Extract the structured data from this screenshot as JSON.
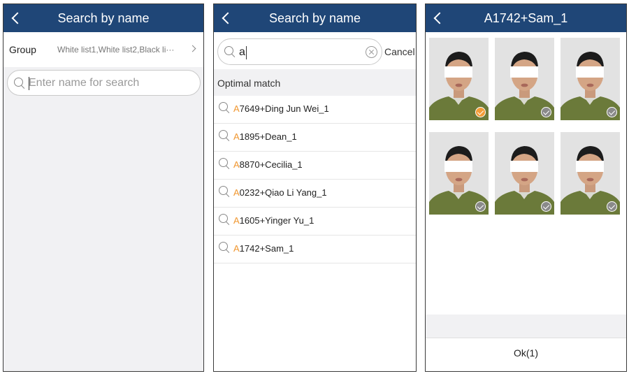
{
  "screen1": {
    "title": "Search by name",
    "group_label": "Group",
    "group_value": "White list1,White list2,Black li···",
    "search_placeholder": "Enter name for search"
  },
  "screen2": {
    "title": "Search by name",
    "search_value": "a",
    "cancel_label": "Cancel",
    "section_label": "Optimal match",
    "results": [
      {
        "hl": "A",
        "rest": "7649+Ding Jun Wei_1"
      },
      {
        "hl": "A",
        "rest": "1895+Dean_1"
      },
      {
        "hl": "A",
        "rest": "8870+Cecilia_1"
      },
      {
        "hl": "A",
        "rest": "0232+Qiao Li Yang_1"
      },
      {
        "hl": "A",
        "rest": "1605+Yinger Yu_1"
      },
      {
        "hl": "A",
        "rest": "1742+Sam_1"
      }
    ]
  },
  "screen3": {
    "title": "A1742+Sam_1",
    "ok_label": "Ok(1)",
    "photos": [
      {
        "selected": true
      },
      {
        "selected": false
      },
      {
        "selected": false
      },
      {
        "selected": false
      },
      {
        "selected": false
      },
      {
        "selected": false
      }
    ]
  },
  "colors": {
    "header_bg": "#1f4677",
    "highlight": "#f0962e",
    "selected_check": "#f29c38",
    "unselected_check": "#8a8a8a"
  },
  "icons": [
    "back-icon",
    "chevron-right-icon",
    "search-icon",
    "clear-icon",
    "check-icon"
  ]
}
